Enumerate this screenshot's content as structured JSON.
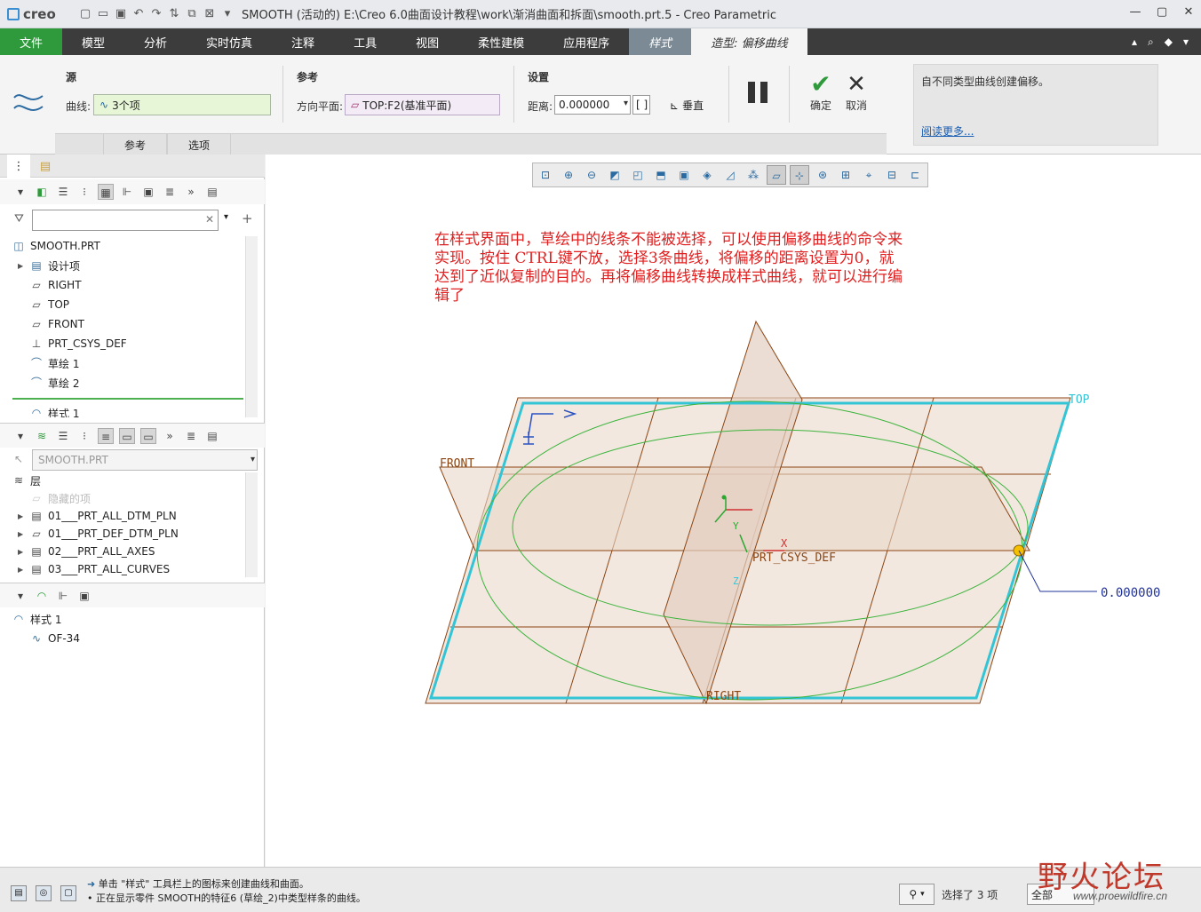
{
  "titlebar": {
    "app_logo": "creo",
    "title": "SMOOTH (活动的) E:\\Creo 6.0曲面设计教程\\work\\渐消曲面和拆面\\smooth.prt.5 - Creo Parametric"
  },
  "ribbon": {
    "tabs": [
      "文件",
      "模型",
      "分析",
      "实时仿真",
      "注释",
      "工具",
      "视图",
      "柔性建模",
      "应用程序",
      "样式",
      "造型: 偏移曲线"
    ],
    "active_tab": "造型: 偏移曲线"
  },
  "dashboard": {
    "source_label": "源",
    "curve_label": "曲线:",
    "curve_value": "3个项",
    "reference_label": "参考",
    "direction_plane_label": "方向平面:",
    "direction_plane_value": "TOP:F2(基准平面)",
    "settings_label": "设置",
    "distance_label": "距离:",
    "distance_value": "0.000000",
    "perpendicular_label": "垂直",
    "subtabs": [
      "参考",
      "选项"
    ],
    "ok_label": "确定",
    "cancel_label": "取消",
    "help_text": "自不同类型曲线创建偏移。",
    "help_link": "阅读更多..."
  },
  "model_tree": {
    "root": "SMOOTH.PRT",
    "items": [
      {
        "label": "设计项",
        "icon": "design-items-icon",
        "expandable": true
      },
      {
        "label": "RIGHT",
        "icon": "datum-plane-icon",
        "expandable": false
      },
      {
        "label": "TOP",
        "icon": "datum-plane-icon",
        "expandable": false
      },
      {
        "label": "FRONT",
        "icon": "datum-plane-icon",
        "expandable": false
      },
      {
        "label": "PRT_CSYS_DEF",
        "icon": "csys-icon",
        "expandable": false
      },
      {
        "label": "草绘 1",
        "icon": "sketch-icon",
        "expandable": false
      },
      {
        "label": "草绘 2",
        "icon": "sketch-icon",
        "expandable": false
      },
      {
        "label": "样式 1",
        "icon": "style-icon",
        "expandable": false
      }
    ]
  },
  "layer_tree": {
    "model": "SMOOTH.PRT",
    "header": "层",
    "items": [
      {
        "label": "隐藏的项",
        "hidden": true
      },
      {
        "label": "01___PRT_ALL_DTM_PLN",
        "hidden": false
      },
      {
        "label": "01___PRT_DEF_DTM_PLN",
        "hidden": false
      },
      {
        "label": "02___PRT_ALL_AXES",
        "hidden": false
      },
      {
        "label": "03___PRT_ALL_CURVES",
        "hidden": false
      }
    ]
  },
  "style_tree": {
    "root": "样式 1",
    "child": "OF-34"
  },
  "graphics": {
    "annotation": "在样式界面中，草绘中的线条不能被选择，可以使用偏移曲线的命令来实现。按住 CTRL键不放，选择3条曲线，将偏移的距离设置为0，就达到了近似复制的目的。再将偏移曲线转换成样式曲线，就可以进行编辑了",
    "labels": {
      "top": "TOP",
      "front": "FRONT",
      "right": "RIGHT",
      "csys": "PRT_CSYS_DEF",
      "axis_x": "X",
      "axis_y": "Y",
      "axis_z": "Z",
      "offset_value": "0.000000"
    },
    "colors": {
      "selected_plane": "#33c4d6",
      "datum": "#8b4513",
      "curve": "#3cb43c",
      "annotation": "#e02020"
    }
  },
  "statusbar": {
    "message1": "单击 \"样式\" 工具栏上的图标来创建曲线和曲面。",
    "message2": "正在显示零件 SMOOTH的特征6 (草绘_2)中类型样条的曲线。",
    "selection": "选择了 3 项",
    "filter": "全部"
  },
  "watermark": {
    "text": "野火论坛",
    "url": "www.proewildfire.cn"
  }
}
